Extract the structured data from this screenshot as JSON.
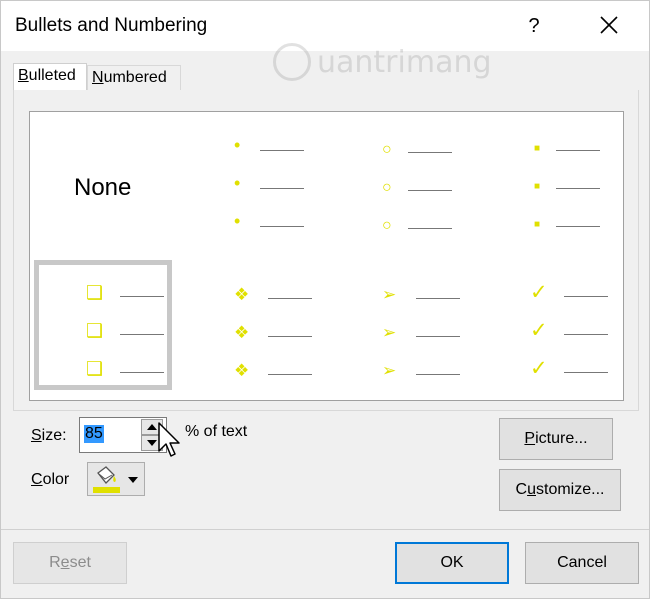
{
  "dialog": {
    "title": "Bullets and Numbering",
    "help_glyph": "?",
    "close_icon": "close-icon"
  },
  "watermark": {
    "text": "uantrimang",
    "icon": "q-logo-icon"
  },
  "tabs": [
    {
      "prefix": "",
      "underlined": "B",
      "suffix": "ulleted",
      "active": true
    },
    {
      "prefix": "",
      "underlined": "N",
      "suffix": "umbered",
      "active": false
    }
  ],
  "bullet_grid": {
    "none_label": "None",
    "styles": [
      {
        "name": "none"
      },
      {
        "name": "filled-round-bullet",
        "glyph": "•"
      },
      {
        "name": "hollow-round-bullet",
        "glyph": "○"
      },
      {
        "name": "filled-square-bullet",
        "glyph": "■"
      },
      {
        "name": "hollow-square-bullet",
        "glyph": "❑",
        "selected": true
      },
      {
        "name": "four-diamond-bullet",
        "glyph": "❖"
      },
      {
        "name": "arrowhead-bullet",
        "glyph": "➢"
      },
      {
        "name": "checkmark-bullet",
        "glyph": "✓"
      }
    ],
    "bullet_color": "#e0e000"
  },
  "size": {
    "label_underlined": "S",
    "label_rest": "ize:",
    "value": "85",
    "unit_label": "% of text"
  },
  "color": {
    "label_underlined": "C",
    "label_rest": "olor",
    "swatch": "#e0e000",
    "icon": "paint-bucket-icon"
  },
  "buttons": {
    "picture": {
      "underlined": "P",
      "rest": "icture..."
    },
    "customize": {
      "underlined": "",
      "pre": "C",
      "u": "u",
      "rest": "stomize..."
    },
    "reset": {
      "pre": "R",
      "u": "e",
      "rest": "set"
    },
    "ok": "OK",
    "cancel": "Cancel"
  }
}
